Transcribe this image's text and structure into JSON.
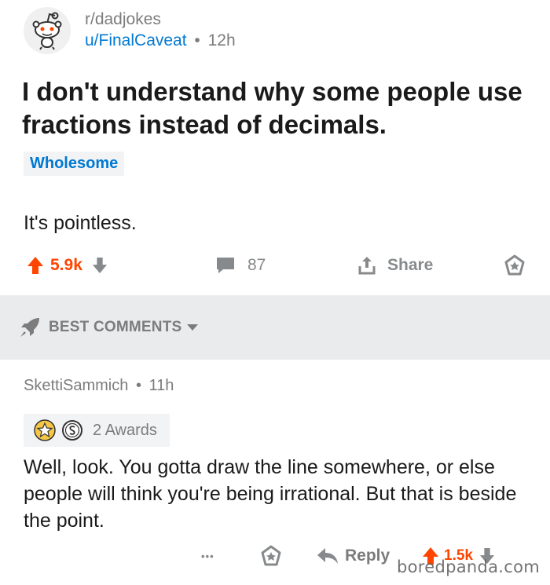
{
  "post": {
    "subreddit": "r/dadjokes",
    "author": "u/FinalCaveat",
    "separator": "•",
    "age": "12h",
    "title": "I don't understand why some people use fractions instead of decimals.",
    "flair": "Wholesome",
    "body": "It's pointless.",
    "score": "5.9k",
    "comment_count": "87",
    "share_label": "Share"
  },
  "sort": {
    "label": "BEST COMMENTS"
  },
  "comment": {
    "author": "SkettiSammich",
    "separator": "•",
    "age": "11h",
    "awards_label": "2 Awards",
    "body": "Well, look.  You gotta draw the line somewhere, or else people will think you're being irrational. But that is beside the point.",
    "more_label": "•••",
    "reply_label": "Reply",
    "score": "1.5k"
  },
  "watermark": "boredpanda.com",
  "colors": {
    "upvote": "#ff4500",
    "link": "#0079d3",
    "muted": "#878a8c",
    "band": "#e9ebed"
  }
}
